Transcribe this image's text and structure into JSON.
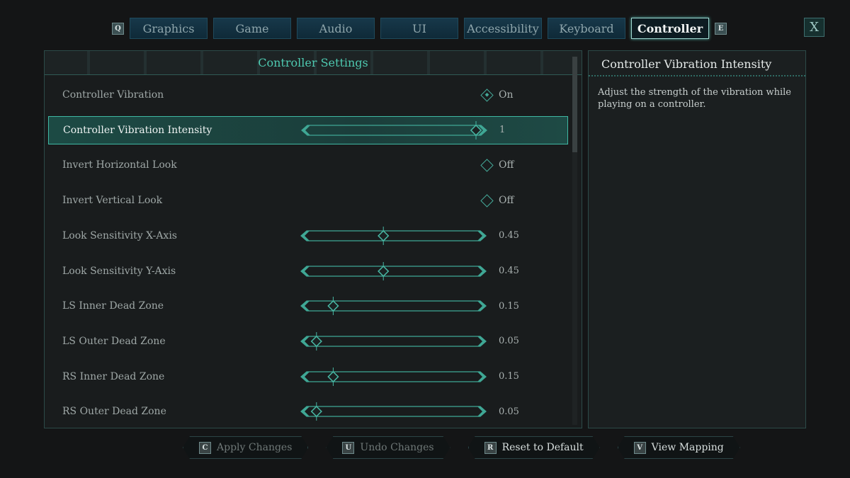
{
  "tabs": {
    "prev_key": "Q",
    "next_key": "E",
    "items": [
      "Graphics",
      "Game",
      "Audio",
      "UI",
      "Accessibility",
      "Keyboard",
      "Controller"
    ],
    "active": "Controller"
  },
  "close_label": "X",
  "panel": {
    "title": "Controller Settings",
    "settings": [
      {
        "label": "Controller Vibration",
        "type": "toggle",
        "value": "On"
      },
      {
        "label": "Controller Vibration Intensity",
        "type": "slider",
        "value": "1",
        "fraction": 1.0,
        "selected": true
      },
      {
        "label": "Invert Horizontal Look",
        "type": "toggle",
        "value": "Off"
      },
      {
        "label": "Invert Vertical Look",
        "type": "toggle",
        "value": "Off"
      },
      {
        "label": "Look Sensitivity X-Axis",
        "type": "slider",
        "value": "0.45",
        "fraction": 0.45
      },
      {
        "label": "Look Sensitivity Y-Axis",
        "type": "slider",
        "value": "0.45",
        "fraction": 0.45
      },
      {
        "label": "LS Inner Dead Zone",
        "type": "slider",
        "value": "0.15",
        "fraction": 0.15
      },
      {
        "label": "LS Outer Dead Zone",
        "type": "slider",
        "value": "0.05",
        "fraction": 0.05
      },
      {
        "label": "RS Inner Dead Zone",
        "type": "slider",
        "value": "0.15",
        "fraction": 0.15
      },
      {
        "label": "RS Outer Dead Zone",
        "type": "slider",
        "value": "0.05",
        "fraction": 0.05
      }
    ]
  },
  "description": {
    "title": "Controller Vibration Intensity",
    "text": "Adjust the strength of the vibration while playing on a controller."
  },
  "buttons": [
    {
      "key": "C",
      "label": "Apply Changes",
      "enabled": false
    },
    {
      "key": "U",
      "label": "Undo Changes",
      "enabled": false
    },
    {
      "key": "R",
      "label": "Reset to Default",
      "enabled": true
    },
    {
      "key": "V",
      "label": "View Mapping",
      "enabled": true
    }
  ],
  "colors": {
    "accent": "#44a898",
    "title": "#4ec9b0"
  }
}
